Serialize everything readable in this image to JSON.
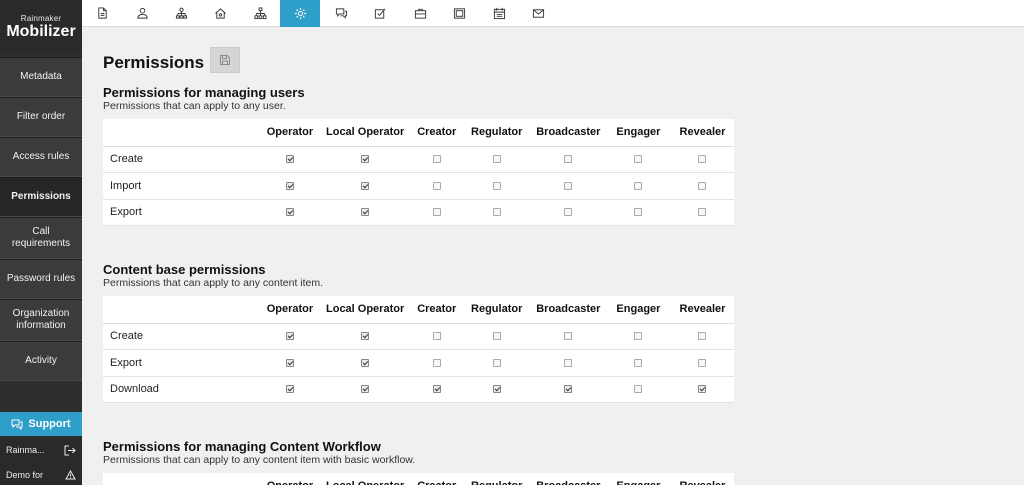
{
  "sidebar": {
    "logo_small": "Rainmaker",
    "logo_big": "Mobilizer",
    "items": [
      {
        "label": "Metadata",
        "active": false
      },
      {
        "label": "Filter order",
        "active": false
      },
      {
        "label": "Access rules",
        "active": false
      },
      {
        "label": "Permissions",
        "active": true
      },
      {
        "label": "Call requirements",
        "active": false
      },
      {
        "label": "Password rules",
        "active": false
      },
      {
        "label": "Organization information",
        "active": false
      },
      {
        "label": "Activity",
        "active": false
      }
    ],
    "support_label": "Support",
    "user_rows": [
      {
        "label": "Rainma...",
        "icon": "logout-icon"
      },
      {
        "label": "Demo for",
        "icon": "warning-icon"
      }
    ]
  },
  "topbar": {
    "icons": [
      "document-icon",
      "user-icon",
      "org-chart-icon",
      "house-icon",
      "hierarchy-icon",
      "gear-icon",
      "chat-icon",
      "checkbox-icon",
      "briefcase-icon",
      "film-icon",
      "calendar-icon",
      "envelope-icon"
    ],
    "active_index": 5,
    "accent_color": "#2d9fc9"
  },
  "main": {
    "title": "Permissions",
    "columns": [
      "",
      "Operator",
      "Local Operator",
      "Creator",
      "Regulator",
      "Broadcaster",
      "Engager",
      "Revealer"
    ],
    "sections": [
      {
        "title": "Permissions for managing users",
        "description": "Permissions that can apply to any user.",
        "rows": [
          {
            "label": "Create",
            "values": [
              true,
              true,
              false,
              false,
              false,
              false,
              false
            ]
          },
          {
            "label": "Import",
            "values": [
              true,
              true,
              false,
              false,
              false,
              false,
              false
            ]
          },
          {
            "label": "Export",
            "values": [
              true,
              true,
              false,
              false,
              false,
              false,
              false
            ]
          }
        ]
      },
      {
        "title": "Content base permissions",
        "description": "Permissions that can apply to any content item.",
        "rows": [
          {
            "label": "Create",
            "values": [
              true,
              true,
              false,
              false,
              false,
              false,
              false
            ]
          },
          {
            "label": "Export",
            "values": [
              true,
              true,
              false,
              false,
              false,
              false,
              false
            ]
          },
          {
            "label": "Download",
            "values": [
              true,
              true,
              true,
              true,
              true,
              false,
              true
            ]
          }
        ]
      },
      {
        "title": "Permissions for managing Content Workflow",
        "description": "Permissions that can apply to any content item with basic workflow.",
        "rows": []
      }
    ]
  }
}
